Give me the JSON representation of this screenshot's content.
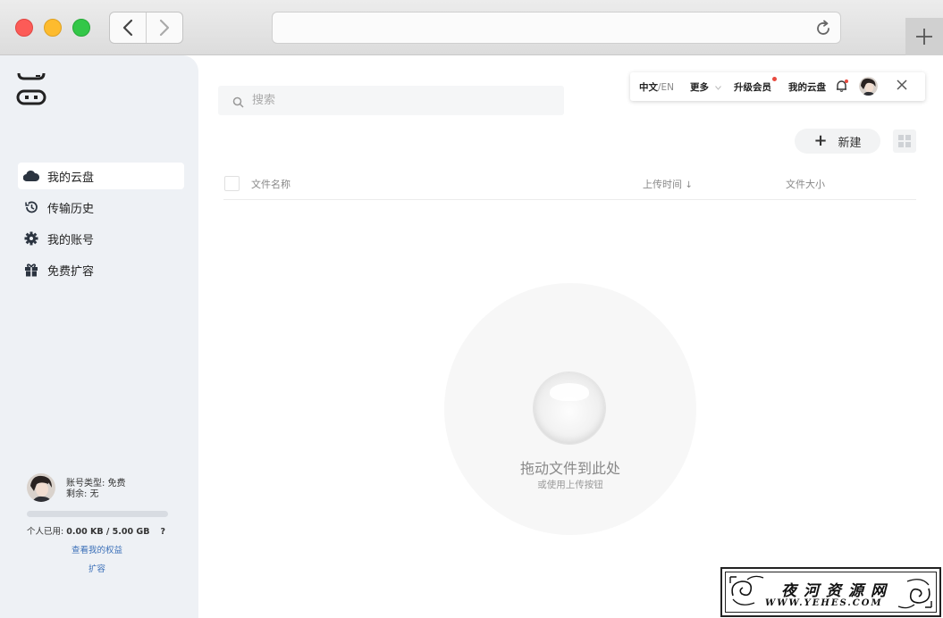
{
  "window": {
    "url": ""
  },
  "sidebar": {
    "items": [
      {
        "label": "我的云盘",
        "icon": "cloud-icon",
        "active": true
      },
      {
        "label": "传输历史",
        "icon": "history-icon",
        "active": false
      },
      {
        "label": "我的账号",
        "icon": "gear-icon",
        "active": false
      },
      {
        "label": "免费扩容",
        "icon": "gift-icon",
        "active": false
      }
    ],
    "account": {
      "type_label": "账号类型: 免费",
      "remaining_label": "剩余: 无",
      "usage_prefix": "个人已用:",
      "usage_value": "0.00 KB / 5.00 GB",
      "usage_fraction": 0,
      "help": "?",
      "rights_link": "查看我的权益",
      "expand_link": "扩容"
    }
  },
  "search": {
    "placeholder": "搜索"
  },
  "topmenu": {
    "lang_active": "中文",
    "lang_sep": "/EN",
    "more": "更多",
    "upgrade": "升级会员",
    "my_cloud": "我的云盘"
  },
  "toolbar": {
    "new_label": "新建",
    "new_icon": "plus-icon"
  },
  "table": {
    "columns": [
      "文件名称",
      "上传时间",
      "文件大小"
    ],
    "sort_indicator": "↓"
  },
  "dropzone": {
    "title": "拖动文件到此处",
    "subtitle": "或使用上传按钮"
  },
  "watermark": {
    "cn": "夜河资源网",
    "en": "WWW.YEHES.COM"
  },
  "colors": {
    "accent_link": "#3a6fb8",
    "badge_red": "#e84a3f",
    "sidebar_bg": "#eef1f5"
  }
}
